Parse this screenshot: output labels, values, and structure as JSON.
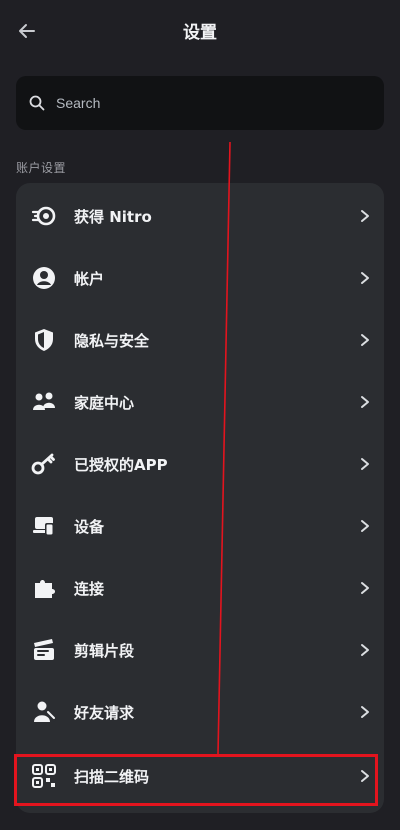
{
  "header": {
    "title": "设置",
    "back_icon": "arrow-left-icon"
  },
  "search": {
    "placeholder": "Search",
    "icon": "search-icon"
  },
  "section": {
    "title": "账户设置"
  },
  "menu": {
    "items": [
      {
        "label": "获得 Nitro",
        "icon": "nitro-icon"
      },
      {
        "label": "帐户",
        "icon": "account-icon"
      },
      {
        "label": "隐私与安全",
        "icon": "shield-icon"
      },
      {
        "label": "家庭中心",
        "icon": "family-icon"
      },
      {
        "label": "已授权的APP",
        "icon": "key-icon"
      },
      {
        "label": "设备",
        "icon": "devices-icon"
      },
      {
        "label": "连接",
        "icon": "puzzle-icon"
      },
      {
        "label": "剪辑片段",
        "icon": "clapperboard-icon"
      },
      {
        "label": "好友请求",
        "icon": "friend-request-icon"
      },
      {
        "label": "扫描二维码",
        "icon": "qr-scan-icon"
      }
    ]
  },
  "colors": {
    "background": "#1f1f24",
    "card": "#2b2d31",
    "search_bg": "#111214",
    "text": "#f2f3f5",
    "muted": "#9b9ca3",
    "annotation_red": "#e3141e"
  }
}
